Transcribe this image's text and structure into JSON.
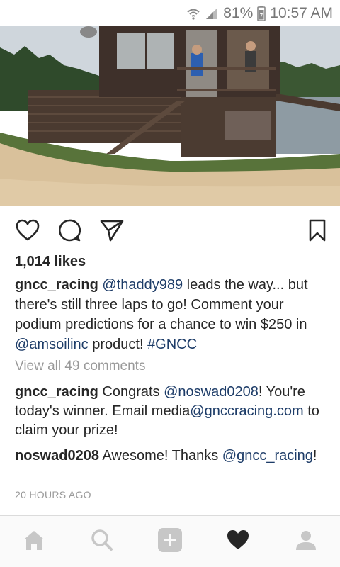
{
  "status_bar": {
    "battery": "81%",
    "time": "10:57 AM"
  },
  "post": {
    "likes": "1,014 likes",
    "caption": {
      "user": "gncc_racing",
      "mention_1": "@thaddy989",
      "text_1": " leads the way... but there's still three laps to go! Comment your podium predictions for a chance to win $250 in ",
      "mention_2": "@amsoilinc",
      "text_2": " product! ",
      "hashtag": "#GNCC"
    },
    "view_all_comments": "View all 49 comments",
    "comments": [
      {
        "user": "gncc_racing",
        "text_1": " Congrats ",
        "mention": "@noswad0208",
        "text_2": "! You're today's winner. Email media",
        "mention_2": "@gnccracing.com",
        "text_3": " to claim your prize!"
      },
      {
        "user": "noswad0208",
        "text_1": " Awesome! Thanks ",
        "mention": "@gncc_racing",
        "text_2": "!"
      }
    ],
    "timestamp": "20 HOURS AGO"
  },
  "icons": {
    "like": "heart-outline-icon",
    "comment": "comment-bubble-icon",
    "share": "paper-plane-icon",
    "save": "bookmark-icon",
    "nav_home": "home-icon",
    "nav_search": "search-icon",
    "nav_add": "add-post-icon",
    "nav_activity": "heart-filled-icon",
    "nav_profile": "profile-icon"
  },
  "colors": {
    "text": "#262626",
    "mention": "#1d3c68",
    "muted": "#999999",
    "nav_inactive": "#c7c7c7"
  }
}
